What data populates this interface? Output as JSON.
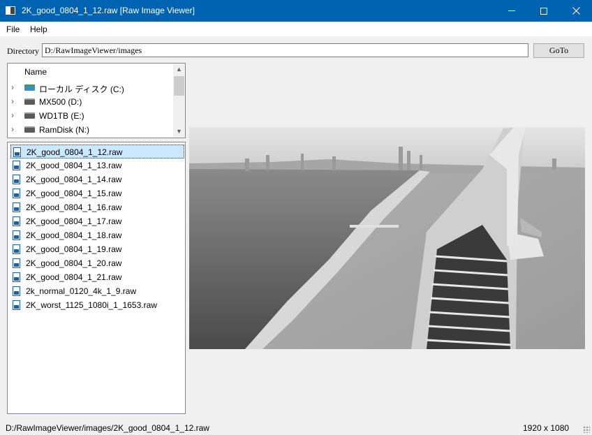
{
  "window": {
    "title": "2K_good_0804_1_12.raw [Raw Image Viewer]"
  },
  "menu": [
    "File",
    "Help"
  ],
  "directory": {
    "label": "Directory",
    "value": "D:/RawImageViewer/images",
    "goto_label": "GoTo"
  },
  "tree": {
    "header": "Name",
    "drives": [
      {
        "label": "ローカル ディスク (C:)",
        "icon": "system-drive-icon"
      },
      {
        "label": "MX500 (D:)",
        "icon": "drive-icon"
      },
      {
        "label": "WD1TB (E:)",
        "icon": "drive-icon"
      },
      {
        "label": "RamDisk (N:)",
        "icon": "drive-icon"
      }
    ]
  },
  "files": [
    "2K_good_0804_1_12.raw",
    "2K_good_0804_1_13.raw",
    "2K_good_0804_1_14.raw",
    "2K_good_0804_1_15.raw",
    "2K_good_0804_1_16.raw",
    "2K_good_0804_1_17.raw",
    "2K_good_0804_1_18.raw",
    "2K_good_0804_1_19.raw",
    "2K_good_0804_1_20.raw",
    "2K_good_0804_1_21.raw",
    "2k_normal_0120_4k_1_9.raw",
    "2K_worst_1125_1080i_1_1653.raw"
  ],
  "selected_file": "2K_good_0804_1_12.raw",
  "status": {
    "path": "D:/RawImageViewer/images/2K_good_0804_1_12.raw",
    "size": "1920 x 1080"
  },
  "colors": {
    "titlebar": "#0063b1",
    "selection": "#cce8ff"
  }
}
